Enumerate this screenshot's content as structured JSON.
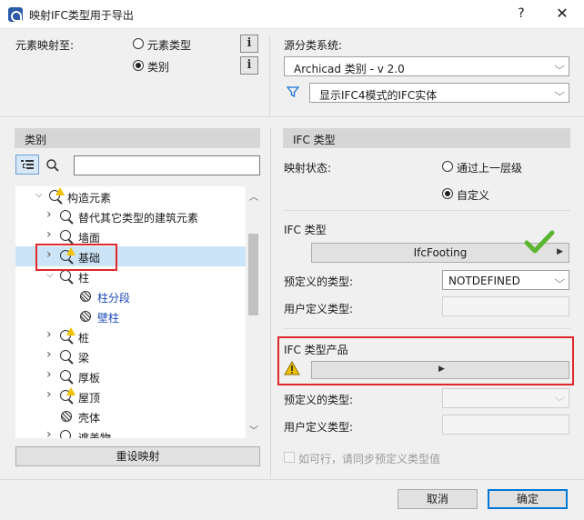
{
  "window": {
    "title": "映射IFC类型用于导出",
    "help_label": "?",
    "close_label": "✕"
  },
  "mapping": {
    "map_to_label": "元素映射至:",
    "option_element_type": "元素类型",
    "option_category": "类别",
    "selected_option": "类别",
    "info_label": "i"
  },
  "classification": {
    "label": "源分类系统:",
    "selected": "Archicad 类别 - v 2.0",
    "filter_selected": "显示IFC4模式的IFC实体"
  },
  "left_panel": {
    "header": "类别",
    "search_value": "",
    "tree": [
      {
        "label": "构造元素",
        "arrow": "down",
        "icon": "warn-node",
        "level": 0
      },
      {
        "label": "替代其它类型的建筑元素",
        "arrow": "right",
        "icon": "node",
        "level": 1
      },
      {
        "label": "墙面",
        "arrow": "right",
        "icon": "node",
        "level": 1
      },
      {
        "label": "基础",
        "arrow": "right",
        "icon": "warn-node",
        "level": 1,
        "selected": true
      },
      {
        "label": "柱",
        "arrow": "down",
        "icon": "node",
        "level": 1
      },
      {
        "label": "柱分段",
        "arrow": "",
        "icon": "hatch",
        "level": 2,
        "blue": true
      },
      {
        "label": "壁柱",
        "arrow": "",
        "icon": "hatch",
        "level": 2,
        "blue": true
      },
      {
        "label": "桩",
        "arrow": "right",
        "icon": "warn-node",
        "level": 1
      },
      {
        "label": "梁",
        "arrow": "right",
        "icon": "node",
        "level": 1
      },
      {
        "label": "厚板",
        "arrow": "right",
        "icon": "node",
        "level": 1
      },
      {
        "label": "屋顶",
        "arrow": "right",
        "icon": "warn-node",
        "level": 1
      },
      {
        "label": "壳体",
        "arrow": "",
        "icon": "hatch",
        "level": 1
      },
      {
        "label": "遮盖物",
        "arrow": "right",
        "icon": "node",
        "level": 1
      }
    ],
    "reset_button": "重设映射"
  },
  "right_panel": {
    "header": "IFC 类型",
    "mapping_status_label": "映射状态:",
    "status_option_parent": "通过上一层级",
    "status_option_custom": "自定义",
    "status_selected": "自定义",
    "ifc_type_section": "IFC 类型",
    "ifc_type_value": "IfcFooting",
    "predefined_type_label": "预定义的类型:",
    "predefined_type_value": "NOTDEFINED",
    "user_defined_type_label": "用户定义类型:",
    "user_defined_type_value": "",
    "ifc_product_section": "IFC 类型产品",
    "ifc_product_value": "",
    "product_predefined_label": "预定义的类型:",
    "product_predefined_value": "",
    "product_user_defined_label": "用户定义类型:",
    "product_user_defined_value": "",
    "sync_checkbox_label": "如可行，请同步预定义类型值",
    "sync_checked": false
  },
  "footer": {
    "cancel": "取消",
    "ok": "确定"
  },
  "colors": {
    "highlight_red": "#e0272c",
    "selection_blue": "#cce4f7",
    "link_blue": "#1a47b8",
    "check_green": "#5cb531",
    "warning_yellow": "#f2c200"
  }
}
